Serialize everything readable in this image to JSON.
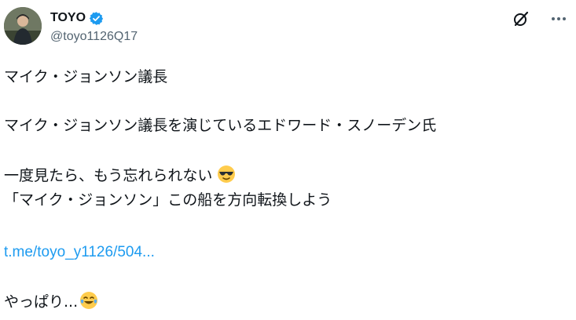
{
  "author": {
    "display_name": "TOYO",
    "handle": "@toyo1126Q17",
    "verified_color": "#1d9bf0"
  },
  "icons": {
    "avatar": "avatar",
    "verified": "verified-badge-icon",
    "grok": "grok-icon",
    "more": "more-options-icon",
    "emoji_sunglasses": "sunglasses-emoji-icon",
    "emoji_tears_of_joy": "tears-of-joy-emoji-icon"
  },
  "tweet": {
    "line1": "マイク・ジョンソン議長",
    "line2": "マイク・ジョンソン議長を演じているエドワード・スノーデン氏",
    "line3": "一度見たら、もう忘れられない",
    "line4": "「マイク・ジョンソン」この船を方向転換しよう",
    "link": "t.me/toyo_y1126/504...",
    "line6": "やっぱり..."
  },
  "colors": {
    "text": "#0f1419",
    "secondary": "#536471",
    "link": "#1d9bf0"
  }
}
